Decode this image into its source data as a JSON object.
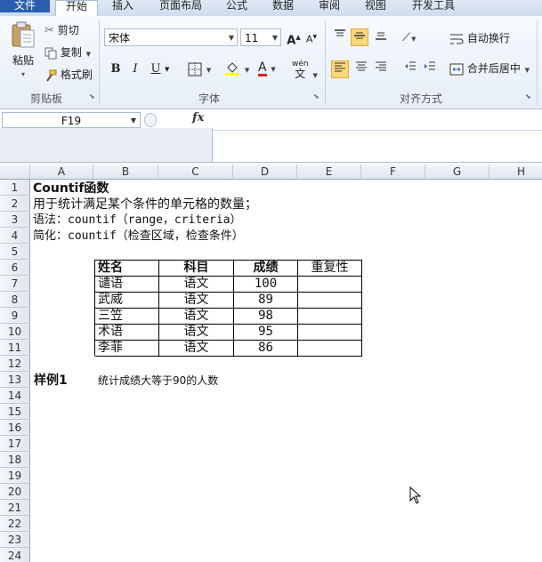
{
  "ribbon_tabs": [
    {
      "label": "文件"
    },
    {
      "label": "开始"
    },
    {
      "label": "插入"
    },
    {
      "label": "页面布局"
    },
    {
      "label": "公式"
    },
    {
      "label": "数据"
    },
    {
      "label": "审阅"
    },
    {
      "label": "视图"
    },
    {
      "label": "开发工具"
    }
  ],
  "clipboard": {
    "paste_label": "粘贴",
    "cut_label": "剪切",
    "copy_label": "复制",
    "format_painter_label": "格式刷",
    "group_label": "剪贴板"
  },
  "font": {
    "font_name": "宋体",
    "font_size": "11",
    "bold_label": "B",
    "italic_label": "I",
    "underline_label": "U",
    "grow_label": "A",
    "shrink_label": "A",
    "font_color_label": "A",
    "phonetic_label": "wén",
    "group_label": "字体"
  },
  "alignment": {
    "wrap_text_label": "自动换行",
    "merge_center_label": "合并后居中",
    "group_label": "对齐方式"
  },
  "formula_bar": {
    "name_box": "F19",
    "fx_label": "fx",
    "formula": ""
  },
  "columns": [
    "A",
    "B",
    "C",
    "D",
    "E",
    "F",
    "G",
    "H"
  ],
  "rows": [
    "1",
    "2",
    "3",
    "4",
    "5",
    "6",
    "7",
    "8",
    "9",
    "10",
    "11",
    "12",
    "13",
    "14",
    "15",
    "16",
    "17",
    "18",
    "19",
    "20",
    "21",
    "22",
    "23",
    "24"
  ],
  "cells": {
    "a1": "Countif函数",
    "a2": "用于统计满足某个条件的单元格的数量；",
    "a3": "语法：countif（range，criteria）",
    "a4": "简化：countif（检查区域，检查条件）",
    "a13": "样例1",
    "b13": "统计成绩大等于90的人数"
  },
  "table": {
    "headers": [
      "姓名",
      "科目",
      "成绩",
      "重复性"
    ],
    "rows": [
      [
        "谴语",
        "语文",
        "100",
        ""
      ],
      [
        "武威",
        "语文",
        "89",
        ""
      ],
      [
        "三笠",
        "语文",
        "98",
        ""
      ],
      [
        "术语",
        "语文",
        "95",
        ""
      ],
      [
        "李菲",
        "语文",
        "86",
        ""
      ]
    ]
  }
}
